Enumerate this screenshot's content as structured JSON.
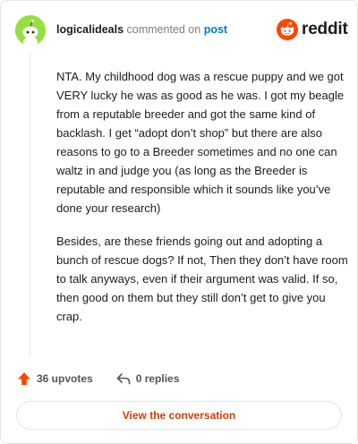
{
  "header": {
    "username": "logicalideals",
    "action_text": "commented on",
    "post_link": "post",
    "brand": "reddit"
  },
  "comment": {
    "paragraphs": [
      "NTA. My childhood dog was a rescue puppy and we got VERY lucky he was as good as he was. I got my beagle from a reputable breeder and got the same kind of backlash. I get “adopt don’t shop” but there are also reasons to go to a Breeder sometimes and no one can waltz in and judge you (as long as the Breeder is reputable and responsible which it sounds like you’ve done your research)",
      "Besides, are these friends going out and adopting a bunch of rescue dogs? If not, Then they don’t have room to talk anyways, even if their argument was valid. If so, then good on them but they still don’t get to give you crap."
    ]
  },
  "actions": {
    "upvotes": "36 upvotes",
    "replies": "0 replies"
  },
  "footer": {
    "view_button": "View the conversation"
  },
  "colors": {
    "brand_orange": "#ff4500",
    "avatar_green": "#94e044",
    "link_blue": "#0079d3",
    "button_text": "#d93a00"
  }
}
